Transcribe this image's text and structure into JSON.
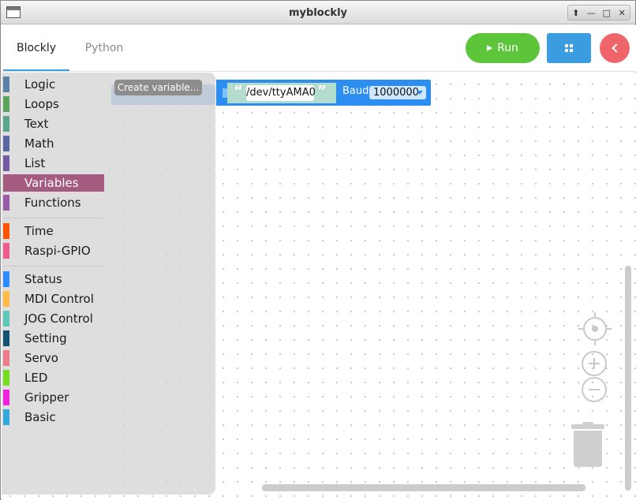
{
  "window": {
    "title": "myblockly",
    "controls": [
      "⬆",
      "—",
      "□",
      "✕"
    ]
  },
  "tabs": [
    {
      "label": "Blockly"
    },
    {
      "label": "Python"
    }
  ],
  "actions": {
    "run_label": "Run"
  },
  "toolbox": {
    "items": [
      {
        "label": "Logic",
        "color": "#5b80a5"
      },
      {
        "label": "Loops",
        "color": "#5ba55b"
      },
      {
        "label": "Text",
        "color": "#5ba58c"
      },
      {
        "label": "Math",
        "color": "#5b67a5"
      },
      {
        "label": "List",
        "color": "#745ba5"
      },
      {
        "label": "Variables",
        "color": "#a55b80"
      },
      {
        "label": "Functions",
        "color": "#995ba5"
      },
      {
        "label": "Time",
        "color": "#ff5500"
      },
      {
        "label": "Raspi-GPIO",
        "color": "#ee5b8f"
      },
      {
        "label": "Status",
        "color": "#2d8cff"
      },
      {
        "label": "MDI Control",
        "color": "#ffbb44"
      },
      {
        "label": "JOG Control",
        "color": "#5ec8b8"
      },
      {
        "label": "Setting",
        "color": "#145373"
      },
      {
        "label": "Servo",
        "color": "#ee7b8b"
      },
      {
        "label": "LED",
        "color": "#77dd22"
      },
      {
        "label": "Gripper",
        "color": "#ee22dd"
      },
      {
        "label": "Basic",
        "color": "#33a8dd"
      }
    ],
    "selected": "Variables"
  },
  "flyout": {
    "create_variable_label": "Create variable..."
  },
  "block": {
    "port_value": "/dev/ttyAMA0",
    "baud_label": "Baud",
    "baud_value": "1000000",
    "open_quote": "“",
    "close_quote": "”"
  },
  "colors": {
    "accent": "#3b9de0",
    "run": "#5cc53a",
    "back": "#f0656a",
    "block": "#2b8ef0"
  }
}
